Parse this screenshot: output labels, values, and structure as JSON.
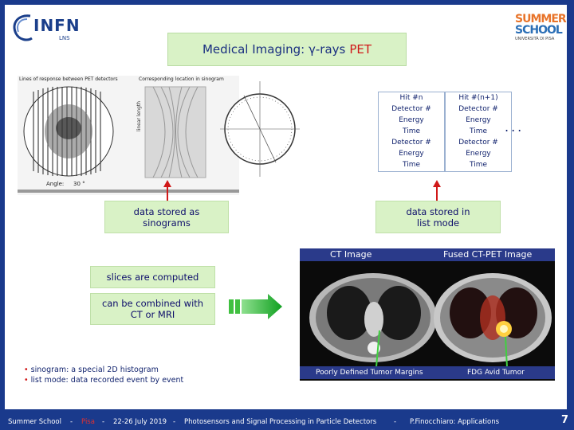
{
  "title": {
    "prefix": "Medical Imaging: γ-rays",
    "highlight": "PET"
  },
  "logos": {
    "infn": "INFN",
    "infn_sub": "LNS",
    "summer_1": "SUMMER",
    "summer_2": "SCHOOL",
    "summer_sub": "UNIVERSITÀ DI PISA"
  },
  "sinogram_figure": {
    "label_left": "Lines of response between PET detectors",
    "label_right": "Corresponding location in sinogram",
    "angle_label": "Angle:",
    "angle_value": "30 °"
  },
  "list_table": {
    "col1": [
      "Hit #n",
      "Detector #",
      "Energy",
      "Time",
      "Detector #",
      "Energy",
      "Time"
    ],
    "col2": [
      "Hit #(n+1)",
      "Detector #",
      "Energy",
      "Time",
      "Detector #",
      "Energy",
      "Time"
    ],
    "ellipsis": "..."
  },
  "boxes": {
    "sinograms": [
      "data stored as",
      "sinograms"
    ],
    "listmode": [
      "data stored in",
      "list mode"
    ],
    "slices": "slices are computed",
    "combined": [
      "can be combined with",
      "CT or MRI"
    ]
  },
  "ct_figure": {
    "ct_label": "CT Image",
    "fused_label": "Fused CT-PET Image",
    "poorly_label": "Poorly Defined Tumor Margins",
    "fdg_label": "FDG Avid Tumor"
  },
  "notes": {
    "n1_term": "sinogram:",
    "n1_text": " a special 2D histogram",
    "n2_term": "list mode:",
    "n2_text": " data recorded event by event"
  },
  "footer": {
    "school": "Summer School",
    "sep": "-",
    "city": "Pisa",
    "dates": "22-26 July 2019",
    "topic": "Photosensors and Signal Processing in Particle Detectors",
    "author": "P.Finocchiaro: Applications",
    "page": "7"
  },
  "colors": {
    "accent_red": "#d01818",
    "text_blue": "#0d1f6b",
    "box_green": "#d9f2c6",
    "frame_blue": "#1a3a8c"
  }
}
